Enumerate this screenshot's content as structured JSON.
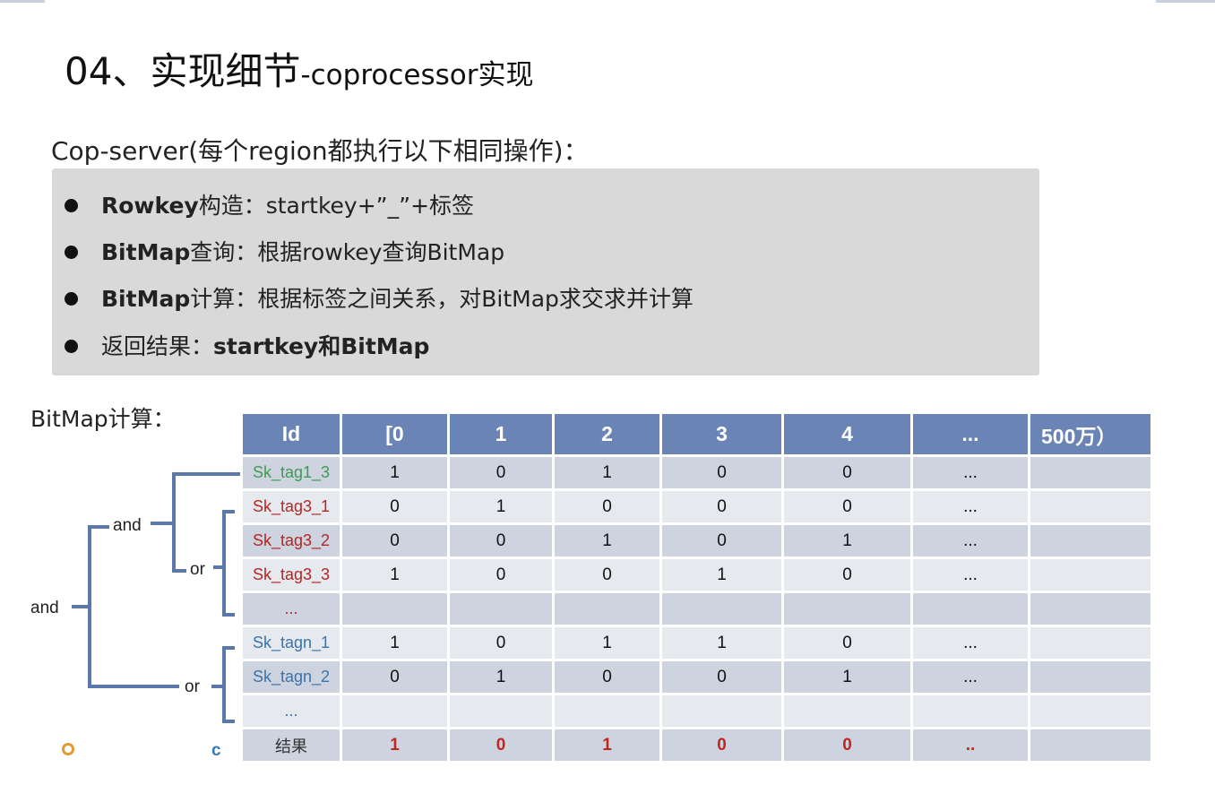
{
  "title": {
    "main": "04、实现细节",
    "sub": "-coprocessor实现"
  },
  "cop_server": "Cop-server(每个region都执行以下相同操作)：",
  "bullets": [
    {
      "key": "Rowkey",
      "text": "构造：startkey+”_”+标签"
    },
    {
      "key": "BitMap",
      "text": "查询：根据rowkey查询BitMap"
    },
    {
      "key": "BitMap",
      "text": "计算：根据标签之间关系，对BitMap求交求并计算"
    },
    {
      "key": "返回结果：",
      "text": "startkey和BitMap"
    }
  ],
  "bitmap_label": "BitMap计算：",
  "table": {
    "headers": [
      "Id",
      "[0",
      "1",
      "2",
      "3",
      "4",
      "...",
      "500万）"
    ],
    "rows": [
      {
        "label": "Sk_tag1_3",
        "cells": [
          "1",
          "0",
          "1",
          "0",
          "0",
          "...",
          ""
        ]
      },
      {
        "label": "Sk_tag3_1",
        "cells": [
          "0",
          "1",
          "0",
          "0",
          "0",
          "...",
          ""
        ]
      },
      {
        "label": "Sk_tag3_2",
        "cells": [
          "0",
          "0",
          "1",
          "0",
          "1",
          "...",
          ""
        ]
      },
      {
        "label": "Sk_tag3_3",
        "cells": [
          "1",
          "0",
          "0",
          "1",
          "0",
          "...",
          ""
        ]
      },
      {
        "label": "...",
        "cells": [
          "",
          "",
          "",
          "",
          "",
          "",
          ""
        ]
      },
      {
        "label": "Sk_tagn_1",
        "cells": [
          "1",
          "0",
          "1",
          "1",
          "0",
          "...",
          ""
        ]
      },
      {
        "label": "Sk_tagn_2",
        "cells": [
          "0",
          "1",
          "0",
          "0",
          "1",
          "...",
          ""
        ]
      },
      {
        "label": "...",
        "cells": [
          "",
          "",
          "",
          "",
          "",
          "",
          ""
        ]
      },
      {
        "label": "结果",
        "cells": [
          "1",
          "0",
          "1",
          "0",
          "0",
          "..",
          ""
        ]
      }
    ]
  },
  "tree": {
    "and_outer": "and",
    "and_inner": "and",
    "or_upper": "or",
    "or_lower": "or"
  },
  "marks": {
    "c": "c"
  },
  "colors": {
    "header": "#6a84b5",
    "row_dark": "#cdd3df",
    "row_light": "#e6e9ee",
    "green": "#3f9b54",
    "red": "#b62624",
    "blue": "#3a73ad",
    "connector": "#5a78aa"
  }
}
